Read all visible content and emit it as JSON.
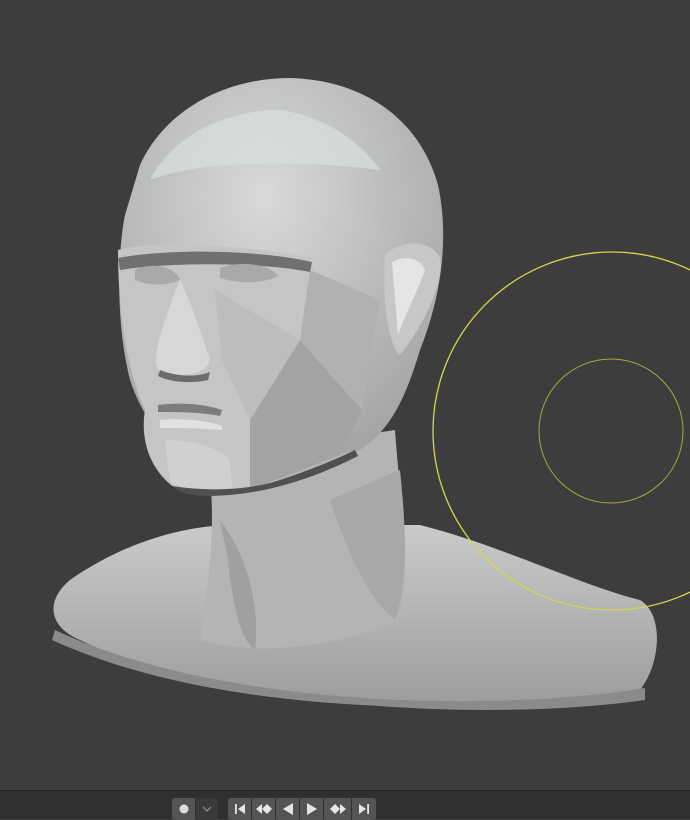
{
  "viewport": {
    "background_color": "#3d3d3d",
    "object_name": "sculpt-head-bust",
    "brush_cursor_color": "#d6d64a"
  },
  "timeline": {
    "record_icon": "record-dot-icon",
    "record_dropdown_icon": "chevron-down-icon",
    "jump_start_icon": "jump-start-icon",
    "prev_keyframe_icon": "prev-keyframe-icon",
    "play_reverse_icon": "play-reverse-icon",
    "play_icon": "play-icon",
    "next_keyframe_icon": "next-keyframe-icon",
    "jump_end_icon": "jump-end-icon"
  }
}
